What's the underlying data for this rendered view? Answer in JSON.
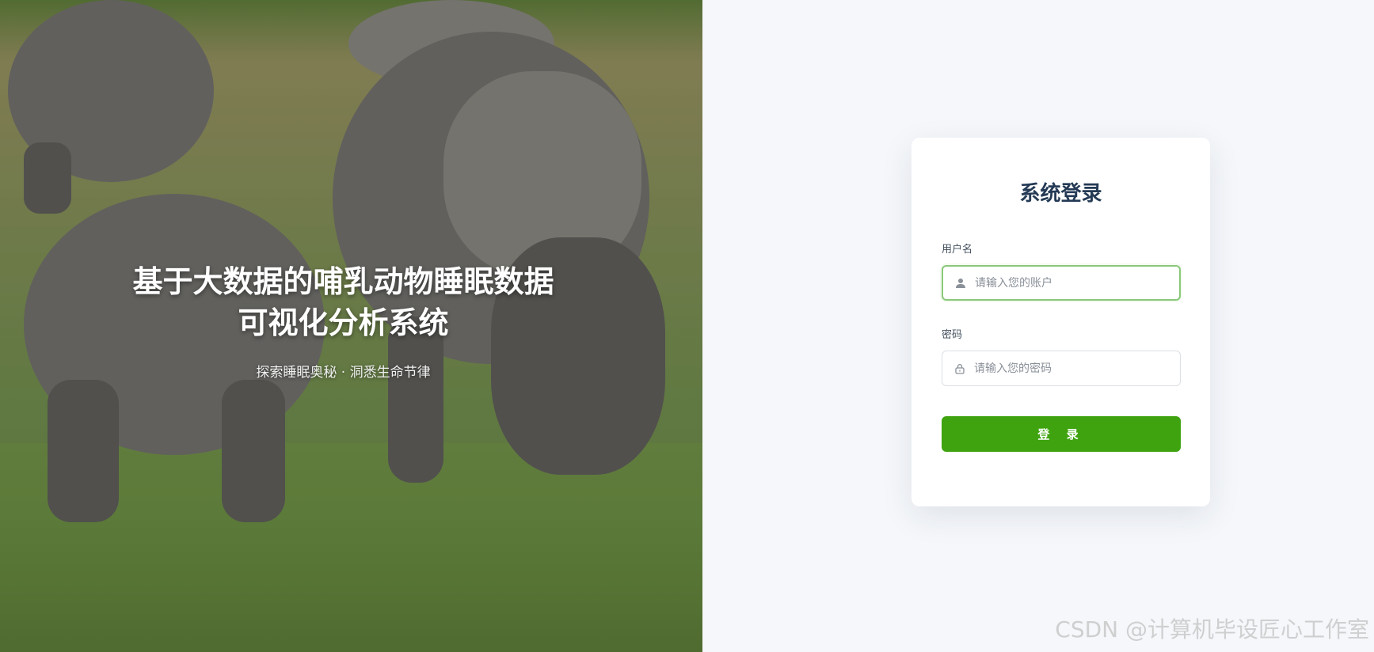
{
  "hero": {
    "title_line1": "基于大数据的哺乳动物睡眠数据",
    "title_line2": "可视化分析系统",
    "subtitle": "探索睡眠奥秘 · 洞悉生命节律"
  },
  "login": {
    "title": "系统登录",
    "username_label": "用户名",
    "username_placeholder": "请输入您的账户",
    "username_value": "",
    "password_label": "密码",
    "password_placeholder": "请输入您的密码",
    "password_value": "",
    "button_label": "登 录",
    "username_icon": "user-icon",
    "password_icon": "lock-icon"
  },
  "watermark": "CSDN @计算机毕设匠心工作室",
  "colors": {
    "accent": "#3fa30f",
    "title": "#243a55",
    "background": "#f5f7fa"
  }
}
